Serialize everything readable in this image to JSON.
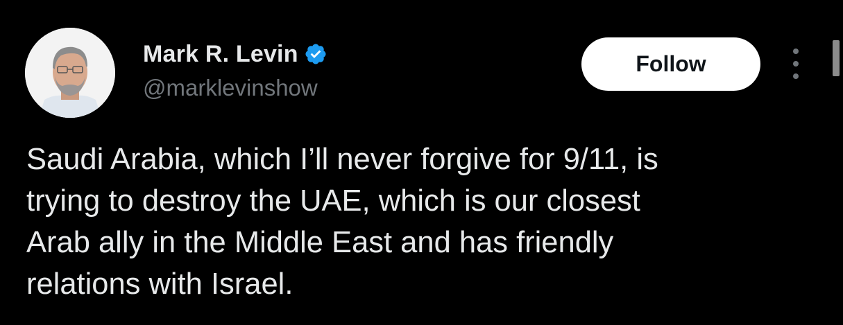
{
  "author": {
    "display_name": "Mark R. Levin",
    "handle": "@marklevinshow",
    "verified": true,
    "verified_color": "#1d9bf0"
  },
  "actions": {
    "follow_label": "Follow"
  },
  "tweet": {
    "lines": [
      "Saudi Arabia, which I’ll never forgive for 9/11,  is",
      "trying to destroy the UAE, which is our closest",
      "Arab ally in the Middle East and has friendly",
      "relations with Israel."
    ]
  },
  "icons": {
    "verified": "verified-badge-icon",
    "more": "more-options-icon"
  },
  "colors": {
    "background": "#000000",
    "text": "#e7e9ea",
    "secondary_text": "#71767b",
    "follow_bg": "#ffffff"
  }
}
